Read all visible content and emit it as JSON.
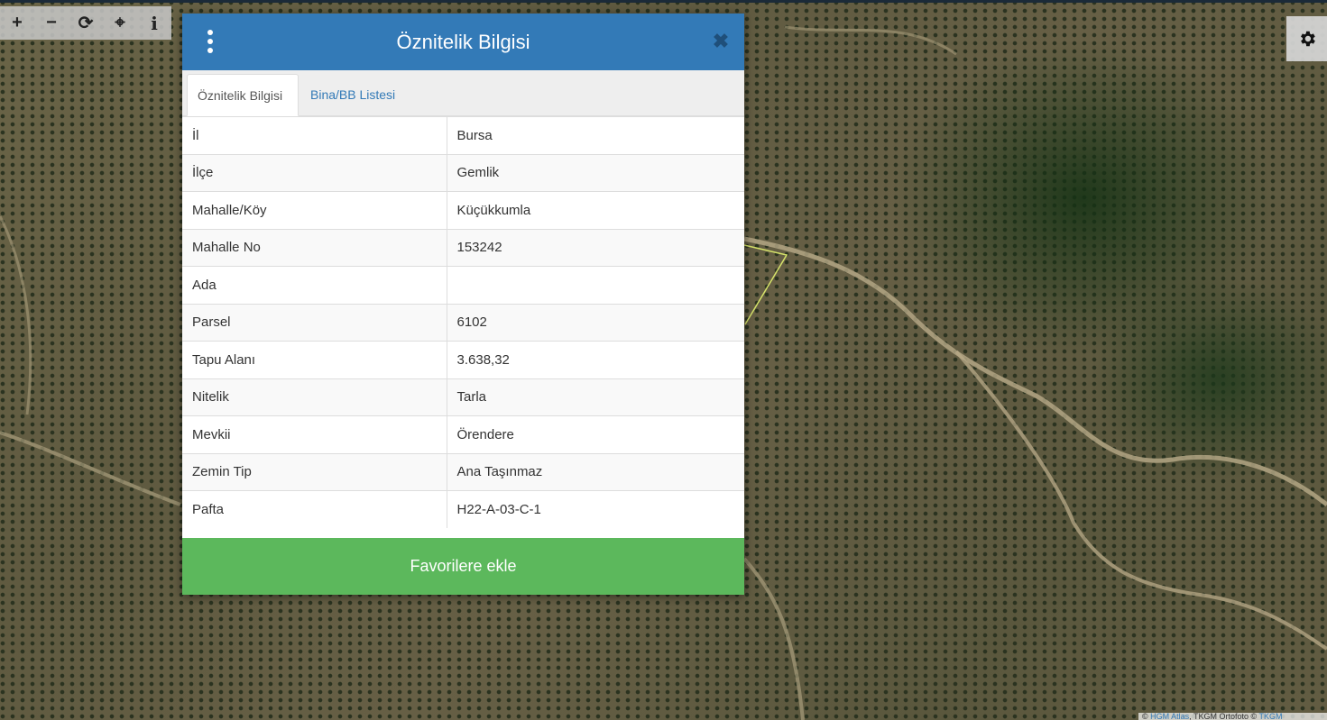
{
  "toolbar": {
    "zoom_in": "+",
    "zoom_out": "−",
    "refresh": "⟳",
    "locate": "⌖",
    "info": "i"
  },
  "modal": {
    "title": "Öznitelik Bilgisi",
    "tabs": [
      {
        "label": "Öznitelik Bilgisi",
        "active": true
      },
      {
        "label": "Bina/BB Listesi",
        "active": false
      }
    ],
    "rows": [
      {
        "key": "İl",
        "value": "Bursa"
      },
      {
        "key": "İlçe",
        "value": "Gemlik"
      },
      {
        "key": "Mahalle/Köy",
        "value": "Küçükkumla"
      },
      {
        "key": "Mahalle No",
        "value": "153242"
      },
      {
        "key": "Ada",
        "value": ""
      },
      {
        "key": "Parsel",
        "value": "6102"
      },
      {
        "key": "Tapu Alanı",
        "value": "3.638,32"
      },
      {
        "key": "Nitelik",
        "value": "Tarla"
      },
      {
        "key": "Mevkii",
        "value": "Örendere"
      },
      {
        "key": "Zemin Tip",
        "value": "Ana Taşınmaz"
      },
      {
        "key": "Pafta",
        "value": "H22-A-03-C-1"
      }
    ],
    "favorite_label": "Favorilere ekle"
  },
  "attribution": {
    "prefix": "©",
    "link1": "HGM Atlas",
    "mid": ", TKGM Ortofoto ©",
    "link2": "TKGM"
  },
  "colors": {
    "header": "#337ab7",
    "favorite_button": "#5cb85c",
    "parcel_outline": "#d6e36a"
  }
}
